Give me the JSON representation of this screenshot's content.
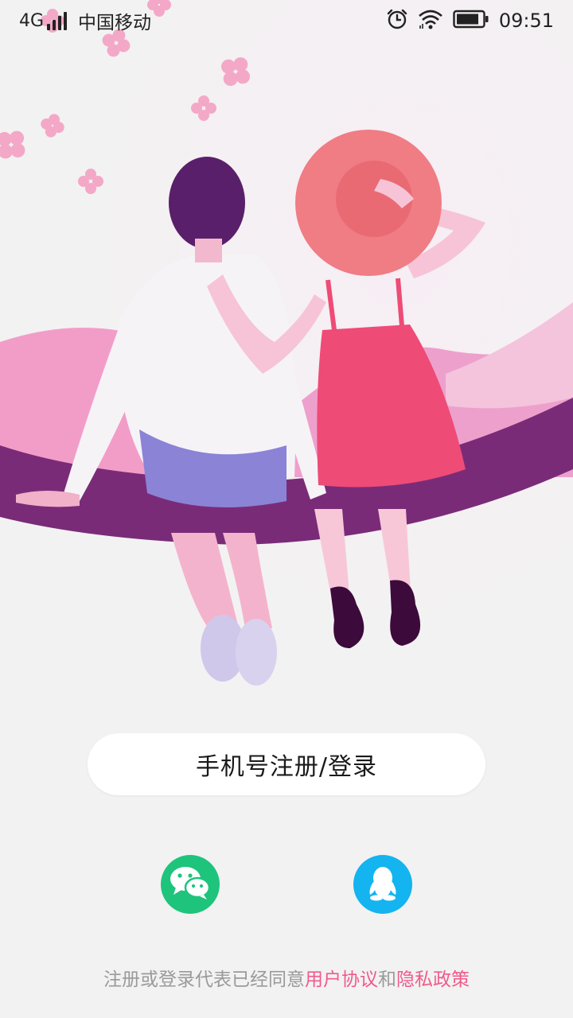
{
  "status_bar": {
    "network": "4G",
    "carrier": "中国移动",
    "time": "09:51",
    "icons": [
      "signal-icon",
      "alarm-icon",
      "wifi-icon",
      "battery-icon"
    ]
  },
  "login": {
    "phone_button_label": "手机号注册/登录",
    "social": [
      {
        "name": "wechat",
        "icon": "wechat-icon",
        "color": "#1ec47c"
      },
      {
        "name": "qq",
        "icon": "qq-icon",
        "color": "#13b4ef"
      }
    ]
  },
  "agreement": {
    "prefix": "注册或登录代表已经同意",
    "user_agreement": "用户协议",
    "and": "和",
    "privacy_policy": "隐私政策"
  },
  "colors": {
    "background": "#f2f2f2",
    "accent_pink": "#ef5b8b",
    "wechat_green": "#1ec47c",
    "qq_blue": "#13b4ef"
  }
}
